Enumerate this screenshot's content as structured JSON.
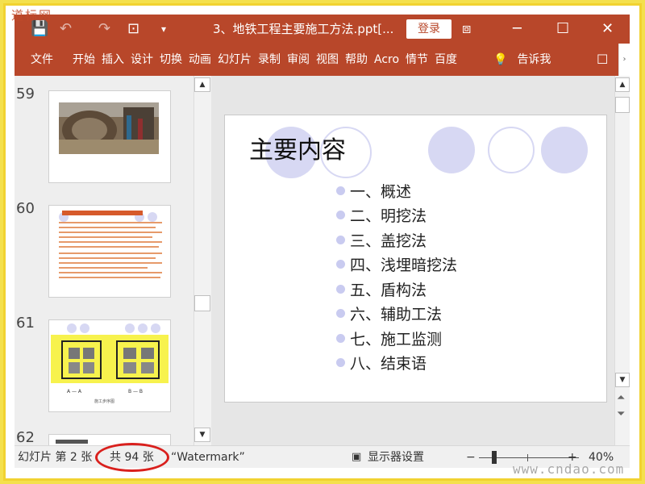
{
  "watermark_top": "道标网",
  "window": {
    "title": "3、地铁工程主要施工方法.ppt[...",
    "login_label": "登录",
    "icons": {
      "save": "💾",
      "undo": "↶",
      "redo": "↷",
      "present": "⊡",
      "customize": "▾",
      "restore_box": "⧈",
      "minimize": "─",
      "maximize": "☐",
      "close": "✕"
    }
  },
  "ribbon": {
    "tabs": [
      "文件",
      "开始",
      "插入",
      "设计",
      "切换",
      "动画",
      "幻灯片",
      "录制",
      "审阅",
      "视图",
      "帮助",
      "Acro",
      "情节",
      "百度"
    ],
    "tell_me_icon": "💡",
    "tell_me_label": "告诉我",
    "comment_icon": "☐",
    "collapse_icon": "›"
  },
  "thumbnails": [
    {
      "number": "59",
      "kind": "photo"
    },
    {
      "number": "60",
      "kind": "text",
      "heading": "■ 盾构始发与到达施工方法"
    },
    {
      "number": "61",
      "kind": "diagram",
      "caption_left": "A — A",
      "caption_right": "B — B",
      "footer": "施工步序图"
    },
    {
      "number": "62",
      "kind": "text",
      "heading": "6.重要工程"
    }
  ],
  "slide": {
    "title": "主要内容",
    "items": [
      "一、概述",
      "二、明挖法",
      "三、盖挖法",
      "四、浅埋暗挖法",
      "五、盾构法",
      "六、辅助工法",
      "七、施工监测",
      "八、结束语"
    ]
  },
  "status": {
    "slide_position": "幻灯片 第 2 张",
    "total": "共 94 张",
    "theme": "“Watermark”",
    "display_settings": "显示器设置",
    "zoom_minus": "−",
    "zoom_plus": "+",
    "zoom": "40%",
    "zoom_level": 0.4
  },
  "watermark_bottom": "www.cndao.com",
  "colors": {
    "accent": "#b8472a",
    "frame": "#f1d231",
    "bullet": "#c9cbf0",
    "circle_fill": "#d7d8f3",
    "annotation": "#d9201d"
  }
}
